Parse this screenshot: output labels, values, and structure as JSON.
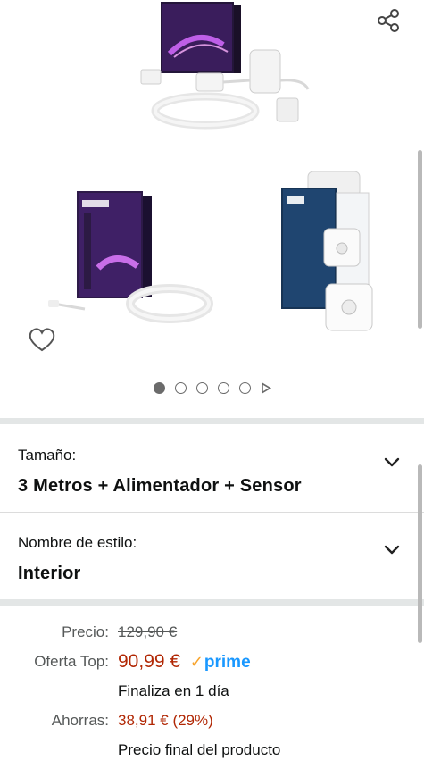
{
  "gallery": {
    "images": [
      "hue-lightstrip-kit",
      "hue-lightstrip-extension",
      "hue-motion-sensor"
    ],
    "dot_count": 5,
    "active_dot": 0
  },
  "icons": {
    "share": "share-icon",
    "wishlist": "heart-outline-icon",
    "carousel_next": "play-triangle-icon",
    "dropdown": "chevron-down-icon"
  },
  "variations": {
    "size": {
      "label": "Tamaño:",
      "value": "3 Metros + Alimentador + Sensor"
    },
    "style": {
      "label": "Nombre de estilo:",
      "value": "Interior"
    }
  },
  "pricing": {
    "list_label": "Precio:",
    "list_price": "129,90 €",
    "deal_label": "Oferta Top:",
    "deal_price": "90,99 €",
    "prime_text": "prime",
    "deal_note": "Finaliza en 1 día",
    "savings_label": "Ahorras:",
    "savings_value": "38,91 € (29%)",
    "final_note": "Precio final del producto"
  },
  "colors": {
    "price_red": "#b12704",
    "prime_blue": "#1a98ff",
    "prime_check": "#f7a32b",
    "text": "#0f1111",
    "muted": "#565959",
    "divider": "#e3e6e6"
  }
}
